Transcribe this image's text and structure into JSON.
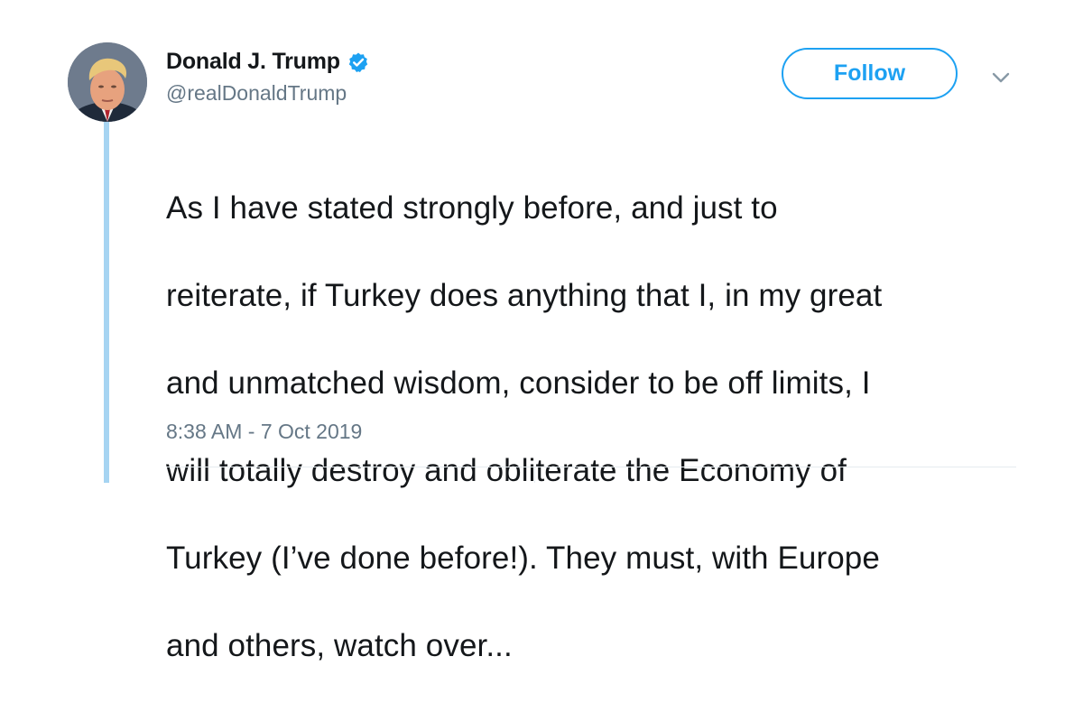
{
  "user": {
    "display_name": "Donald J. Trump",
    "handle": "@realDonaldTrump",
    "verified": true,
    "avatar_icon": "profile-photo"
  },
  "actions": {
    "follow_label": "Follow",
    "menu_icon": "chevron-down-icon"
  },
  "tweet": {
    "lines": [
      "As I have stated strongly before, and just to",
      "reiterate, if Turkey does anything that I, in my great",
      "and unmatched wisdom, consider to be off limits, I",
      "will totally destroy and obliterate the Economy of",
      "Turkey (I’ve done before!). They must, with Europe",
      "and others, watch over..."
    ],
    "timestamp": "8:38 AM - 7 Oct 2019"
  },
  "colors": {
    "accent": "#1da1f2",
    "thread_line": "#a6d4f2",
    "secondary_text": "#657786",
    "primary_text": "#14171a"
  }
}
